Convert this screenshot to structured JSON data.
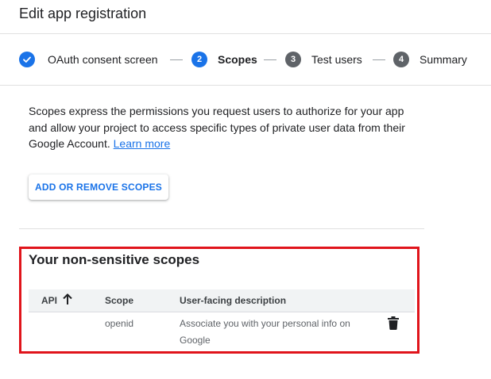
{
  "header": {
    "title": "Edit app registration"
  },
  "stepper": {
    "steps": [
      {
        "number": "1",
        "label": "OAuth consent screen",
        "state": "done",
        "icon": "check-icon"
      },
      {
        "number": "2",
        "label": "Scopes",
        "state": "active"
      },
      {
        "number": "3",
        "label": "Test users",
        "state": "pending"
      },
      {
        "number": "4",
        "label": "Summary",
        "state": "pending"
      }
    ]
  },
  "intro": {
    "text": "Scopes express the permissions you request users to authorize for your app and allow your project to access specific types of private user data from their Google Account.",
    "link_label": "Learn more"
  },
  "scopes_button": {
    "label": "ADD OR REMOVE SCOPES"
  },
  "non_sensitive": {
    "title": "Your non-sensitive scopes",
    "columns": {
      "api": "API",
      "scope": "Scope",
      "description": "User-facing description"
    },
    "sort_icon": "arrow-up-icon",
    "rows": [
      {
        "api": "",
        "scope": "openid",
        "description": "Associate you with your personal info on Google",
        "action_icon": "trash-icon"
      }
    ]
  },
  "colors": {
    "accent": "#1a73e8",
    "pending_step": "#5f6368",
    "highlight_border": "#e0141b"
  }
}
